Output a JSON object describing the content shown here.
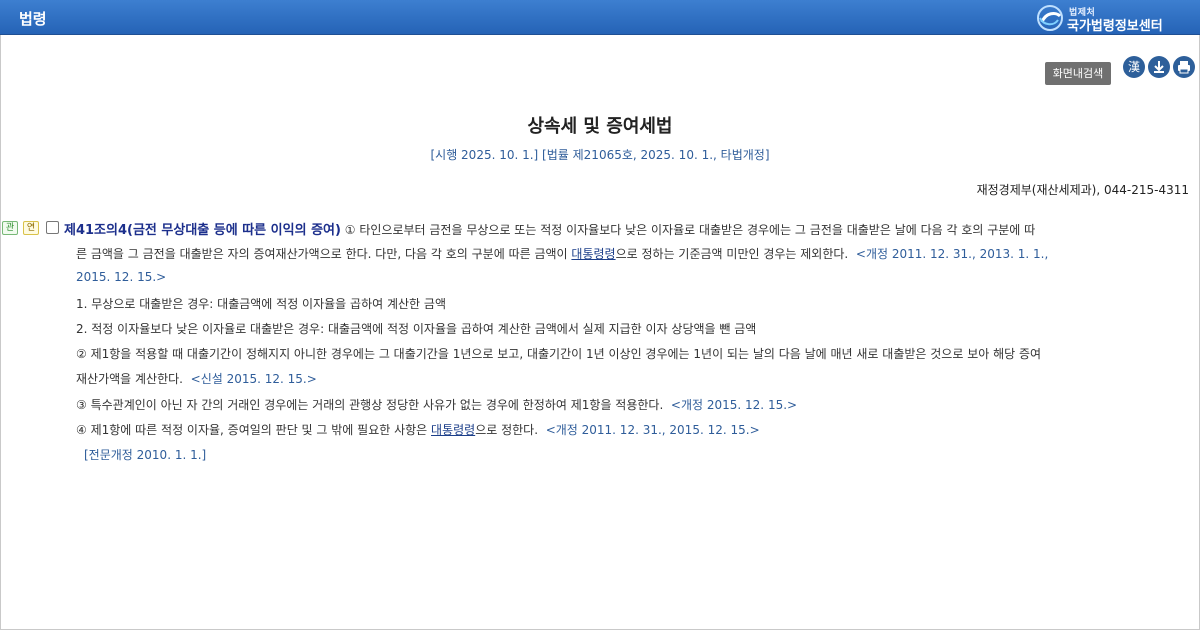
{
  "header": {
    "title": "법령",
    "logo_small": "법제처",
    "logo_big": "국가법령정보센터"
  },
  "toolbar": {
    "search_label": "화면내검색",
    "hanja_label": "漢",
    "icons": [
      "hanja-icon",
      "download-icon",
      "print-icon"
    ]
  },
  "law": {
    "title": "상속세 및 증여세법",
    "subtitle": "[시행 2025. 10. 1.] [법률 제21065호, 2025. 10. 1., 타법개정]",
    "ministry": "재정경제부(재산세제과), 044-215-4311"
  },
  "article": {
    "tag1": "관",
    "tag2": "연",
    "title": "제41조의4(금전 무상대출 등에 따른 이익의 증여)",
    "p1_l1": "① 타인으로부터 금전을 무상으로 또는 적정 이자율보다 낮은 이자율로 대출받은 경우에는 그 금전을 대출받은 날에 다음 각 호의 구분에 따",
    "p1_l2_a": "른 금액을 그 금전을 대출받은 자의 증여재산가액으로 한다. 다만, 다음 각 호의 구분에 따른 금액이 ",
    "p1_l2_link": "대통령령",
    "p1_l2_b": "으로 정하는 기준금액 미만인 경우는 제외한다.",
    "p1_l2_amend": "<개정 2011. 12. 31., 2013. 1. 1.,",
    "p1_l3_amend": "2015. 12. 15.>",
    "item1": "1. 무상으로 대출받은 경우: 대출금액에 적정 이자율을 곱하여 계산한 금액",
    "item2": "2. 적정 이자율보다 낮은 이자율로 대출받은 경우: 대출금액에 적정 이자율을 곱하여 계산한 금액에서 실제 지급한 이자 상당액을 뺀 금액",
    "p2_l1": "② 제1항을 적용할 때 대출기간이 정해지지 아니한 경우에는 그 대출기간을 1년으로 보고, 대출기간이 1년 이상인 경우에는 1년이 되는 날의 다음 날에 매년 새로 대출받은 것으로 보아 해당 증여",
    "p2_l2": "재산가액을 계산한다.",
    "p2_amend": "<신설 2015. 12. 15.>",
    "p3": "③ 특수관계인이 아닌 자 간의 거래인 경우에는 거래의 관행상 정당한 사유가 없는 경우에 한정하여 제1항을 적용한다.",
    "p3_amend": "<개정 2015. 12. 15.>",
    "p4_a": "④ 제1항에 따른 적정 이자율, 증여일의 판단 및 그 밖에 필요한 사항은 ",
    "p4_link": "대통령령",
    "p4_b": "으로 정한다.",
    "p4_amend": "<개정 2011. 12. 31., 2015. 12. 15.>",
    "full_amend": "[전문개정 2010. 1. 1.]"
  }
}
